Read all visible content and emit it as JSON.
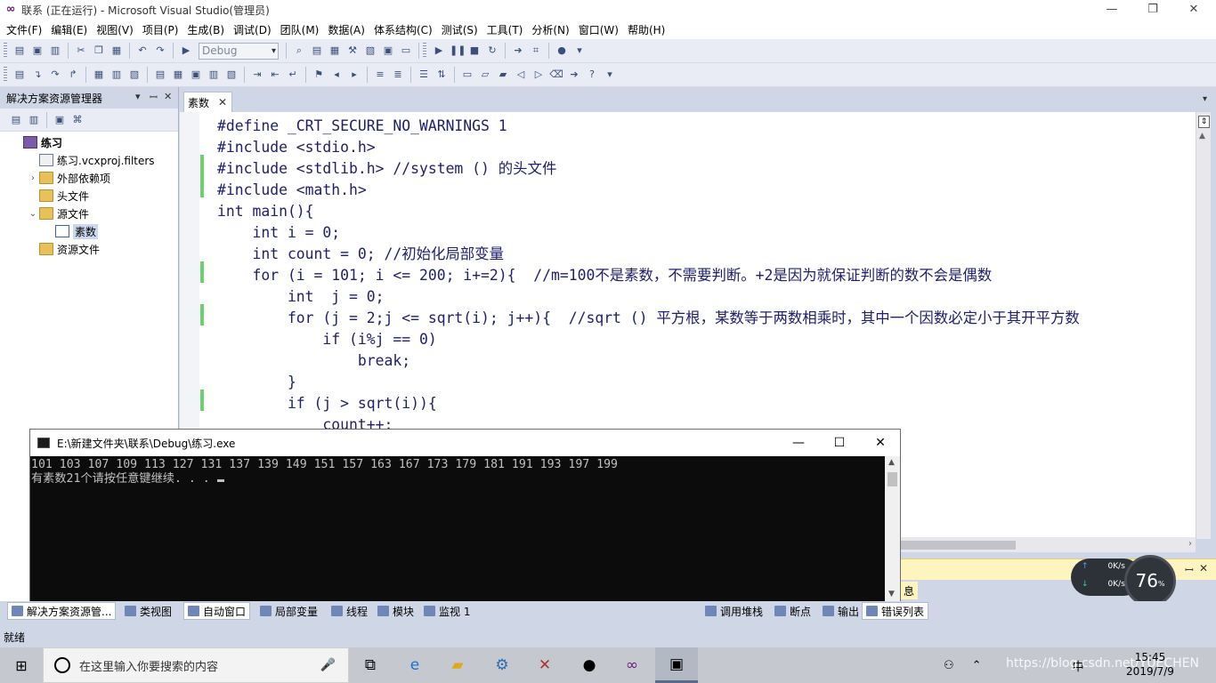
{
  "window": {
    "title": "联系 (正在运行) - Microsoft Visual Studio(管理员)",
    "logo_glyph": "∞",
    "minimize": "—",
    "restore": "❐",
    "close": "✕"
  },
  "menu": [
    "文件(F)",
    "编辑(E)",
    "视图(V)",
    "项目(P)",
    "生成(B)",
    "调试(D)",
    "团队(M)",
    "数据(A)",
    "体系结构(C)",
    "测试(S)",
    "工具(T)",
    "分析(N)",
    "窗口(W)",
    "帮助(H)"
  ],
  "toolbar": {
    "config_value": "Debug"
  },
  "solution_explorer": {
    "title": "解决方案资源管理器",
    "pin": "ꟷ",
    "dropdown": "▾",
    "close": "✕",
    "items": [
      {
        "label": "练习",
        "arrow": "",
        "icon": "project-icon",
        "indent": 0,
        "bold": true
      },
      {
        "label": "练习.vcxproj.filters",
        "arrow": "",
        "icon": "filter-icon",
        "indent": 1
      },
      {
        "label": "外部依赖项",
        "arrow": "›",
        "icon": "folder-icon",
        "indent": 1
      },
      {
        "label": "头文件",
        "arrow": "",
        "icon": "folder-icon",
        "indent": 1
      },
      {
        "label": "源文件",
        "arrow": "⌄",
        "icon": "folder-icon",
        "indent": 1
      },
      {
        "label": "素数",
        "arrow": "",
        "icon": "cfile-icon",
        "indent": 2,
        "selected": true
      },
      {
        "label": "资源文件",
        "arrow": "",
        "icon": "folder-icon",
        "indent": 1
      }
    ]
  },
  "editor": {
    "tab_label": "素数",
    "tab_close": "✕",
    "lines": [
      "#define _CRT_SECURE_NO_WARNINGS 1",
      "#include <stdio.h>",
      "#include <stdlib.h> //system () 的头文件",
      "#include <math.h>",
      "int main(){",
      "    int i = 0;",
      "    int count = 0; //初始化局部变量",
      "    for (i = 101; i <= 200; i+=2){  //m=100不是素数，不需要判断。+2是因为就保证判断的数不会是偶数",
      "        int  j = 0;",
      "        for (j = 2;j <= sqrt(i); j++){  //sqrt () 平方根，某数等于两数相乘时，其中一个因数必定小于其开平方数",
      "            if (i%j == 0)",
      "                break;",
      "        }",
      "        if (j > sqrt(i)){",
      "            count++;"
    ]
  },
  "console": {
    "title": "E:\\新建文件夹\\联系\\Debug\\练习.exe",
    "minimize": "—",
    "maximize": "☐",
    "close": "✕",
    "lines": [
      "101 103 107 109 113 127 131 137 139 149 151 157 163 167 173 179 181 191 193 197 199",
      "有素数21个请按任意键继续. . . "
    ]
  },
  "lower_panel": {
    "info_tab": "息",
    "pin": "ꟷ",
    "close": "✕"
  },
  "bottom_tabs": [
    {
      "label": "解决方案资源管...",
      "active": true
    },
    {
      "label": "类视图",
      "active": false
    },
    {
      "label": "自动窗口",
      "active": true
    },
    {
      "label": "局部变量",
      "active": false
    },
    {
      "label": "线程",
      "active": false
    },
    {
      "label": "模块",
      "active": false
    },
    {
      "label": "监视 1",
      "active": false
    },
    {
      "label": "调用堆栈",
      "active": false
    },
    {
      "label": "断点",
      "active": false
    },
    {
      "label": "输出",
      "active": false
    },
    {
      "label": "错误列表",
      "active": true
    }
  ],
  "status": "就绪",
  "net_widget": {
    "up": "0K/s",
    "down": "0K/s",
    "percent": "76",
    "percent_unit": "%"
  },
  "taskbar": {
    "search_placeholder": "在这里输入你要搜索的内容",
    "ime": "中",
    "time": "15:45",
    "date": "2019/7/9",
    "watermark": "https://blog.csdn.net/YUECHEN"
  }
}
